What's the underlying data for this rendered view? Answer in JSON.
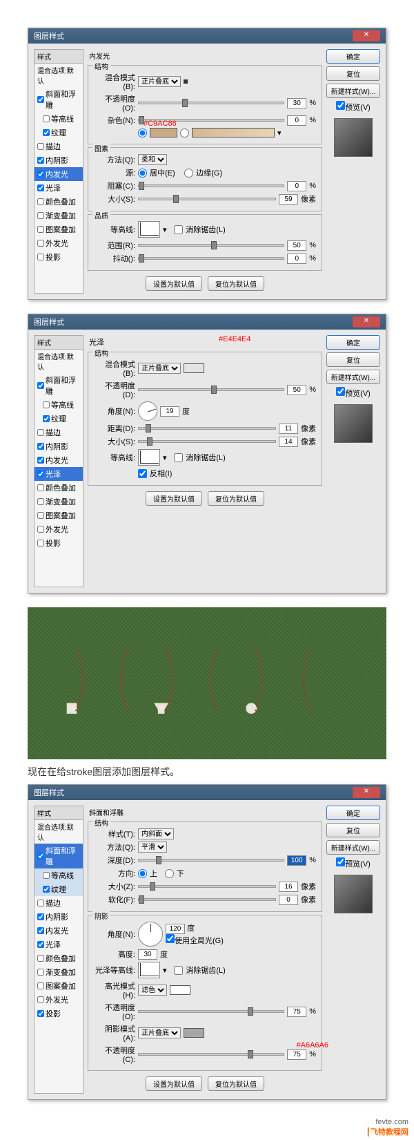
{
  "dialog_title": "图层样式",
  "buttons": {
    "ok": "确定",
    "cancel": "复位",
    "new": "新建样式(W)...",
    "preview": "预览(V)",
    "default": "设置为默认值",
    "reset": "复位为默认值"
  },
  "sidebar": {
    "title": "样式",
    "blend": "混合选项:默认",
    "items": [
      "斜面和浮雕",
      "等高线",
      "纹理",
      "描边",
      "内阴影",
      "内发光",
      "光泽",
      "颜色叠加",
      "渐变叠加",
      "图案叠加",
      "外发光",
      "投影"
    ]
  },
  "d1": {
    "selected": "内发光",
    "checked": [
      "斜面和浮雕",
      "纹理",
      "内阴影",
      "内发光",
      "光泽"
    ],
    "title": "内发光",
    "struct": "结构",
    "elem": "图素",
    "qual": "品质",
    "blend_mode": "混合模式(B):",
    "blend_val": "正片叠底",
    "opacity": "不透明度(O):",
    "opacity_val": "30",
    "noise": "杂色(N):",
    "noise_val": "0",
    "color_hex": "#C9AC86",
    "technique": "方法(Q):",
    "technique_val": "柔和",
    "source": "源:",
    "center": "居中(E)",
    "edge": "边缘(G)",
    "choke": "阻塞(C):",
    "choke_val": "0",
    "size": "大小(S):",
    "size_val": "59",
    "px": "像素",
    "contour": "等高线:",
    "anti": "消除锯齿(L)",
    "range": "范围(R):",
    "range_val": "50",
    "jitter": "抖动():",
    "jitter_val": "0",
    "pct": "%"
  },
  "d2": {
    "selected": "光泽",
    "checked": [
      "斜面和浮雕",
      "纹理",
      "内阴影",
      "内发光",
      "光泽"
    ],
    "title": "光泽",
    "struct": "结构",
    "color_hex": "#E4E4E4",
    "blend_mode": "混合模式(B):",
    "blend_val": "正片叠底",
    "opacity": "不透明度(D):",
    "opacity_val": "50",
    "angle": "角度(N):",
    "angle_val": "19",
    "deg": "度",
    "dist": "距离(D):",
    "dist_val": "11",
    "px": "像素",
    "size": "大小(S):",
    "size_val": "14",
    "contour": "等高线:",
    "anti": "消除锯齿(L)",
    "invert": "反相(I)"
  },
  "caption": "现在在给stroke图层添加图层样式。",
  "d3": {
    "selected": "斜面和浮雕",
    "checked": [
      "斜面和浮雕",
      "纹理",
      "内阴影",
      "内发光",
      "光泽",
      "投影"
    ],
    "title": "斜面和浮雕",
    "struct": "结构",
    "shade": "阴影",
    "style": "样式(T):",
    "style_val": "内斜面",
    "technique": "方法(Q):",
    "technique_val": "平滑",
    "depth": "深度(D):",
    "depth_val": "100",
    "dir": "方向:",
    "up": "上",
    "down": "下",
    "size": "大小(Z):",
    "size_val": "16",
    "px": "像素",
    "soften": "软化(F):",
    "soften_val": "0",
    "angle": "角度(N):",
    "angle_val": "120",
    "deg": "度",
    "global": "使用全局光(G)",
    "alt": "高度:",
    "alt_val": "30",
    "gloss": "光泽等高线:",
    "anti": "消除锯齿(L)",
    "hilite": "高光模式(H):",
    "hilite_val": "滤色",
    "h_opacity": "不透明度(O):",
    "h_opacity_val": "75",
    "shadow": "阴影模式(A):",
    "shadow_val": "正片叠底",
    "shadow_hex": "#A6A6A6",
    "s_opacity": "不透明度(C):",
    "s_opacity_val": "75",
    "pct": "%"
  },
  "footer": {
    "url": "fevte.com",
    "brand": "飞特教程网"
  }
}
